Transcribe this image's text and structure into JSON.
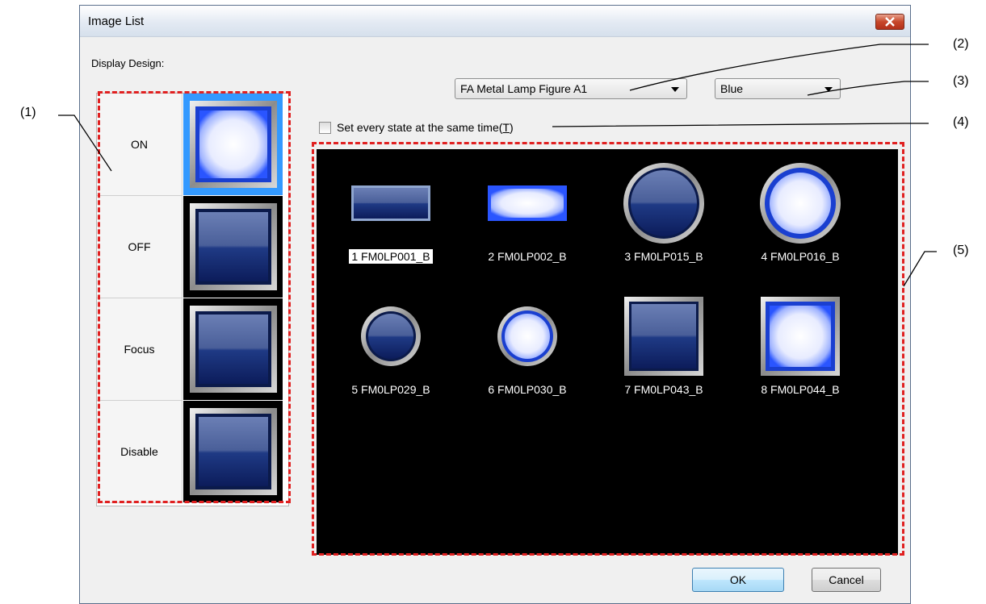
{
  "window": {
    "title": "Image List"
  },
  "display_design_label": "Display Design:",
  "states": [
    {
      "label": "ON",
      "selected": true
    },
    {
      "label": "OFF",
      "selected": false
    },
    {
      "label": "Focus",
      "selected": false
    },
    {
      "label": "Disable",
      "selected": false
    }
  ],
  "figure_select": {
    "value": "FA Metal Lamp Figure A1"
  },
  "color_select": {
    "value": "Blue"
  },
  "same_time_checkbox": {
    "label": "Set every state at the same time(",
    "accel": "T",
    "label_end": ")",
    "checked": false
  },
  "images": [
    {
      "caption": "1 FM0LP001_B",
      "selected": true
    },
    {
      "caption": "2 FM0LP002_B",
      "selected": false
    },
    {
      "caption": "3 FM0LP015_B",
      "selected": false
    },
    {
      "caption": "4 FM0LP016_B",
      "selected": false
    },
    {
      "caption": "5 FM0LP029_B",
      "selected": false
    },
    {
      "caption": "6 FM0LP030_B",
      "selected": false
    },
    {
      "caption": "7 FM0LP043_B",
      "selected": false
    },
    {
      "caption": "8 FM0LP044_B",
      "selected": false
    }
  ],
  "buttons": {
    "ok": "OK",
    "cancel": "Cancel"
  },
  "callouts": [
    "(1)",
    "(2)",
    "(3)",
    "(4)",
    "(5)"
  ],
  "colors": {
    "annotation": "#e02020",
    "selection": "#3399ff",
    "lamp_blue": "#2255cc"
  }
}
